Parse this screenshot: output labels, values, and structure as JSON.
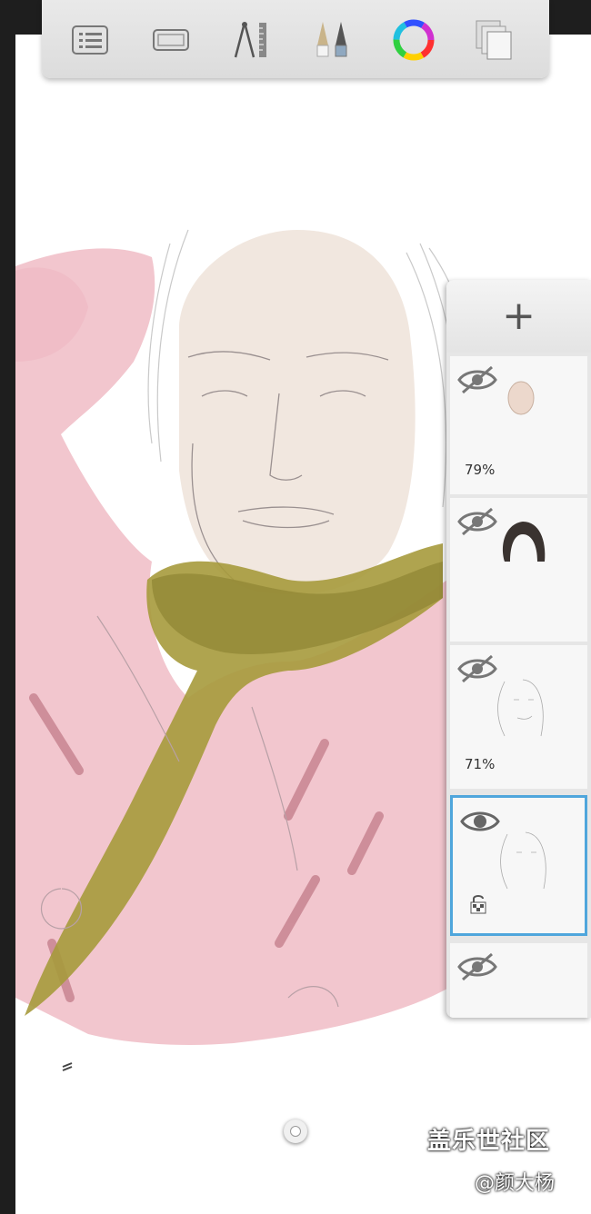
{
  "toolbar": {
    "tools": [
      {
        "name": "menu-list-icon"
      },
      {
        "name": "canvas-frame-icon"
      },
      {
        "name": "guides-ruler-icon"
      },
      {
        "name": "brushes-icon"
      },
      {
        "name": "color-wheel-icon"
      },
      {
        "name": "layers-icon"
      }
    ]
  },
  "layers": {
    "add_label": "+",
    "items": [
      {
        "visible": false,
        "opacity": "79%",
        "locked": false,
        "selected": false
      },
      {
        "visible": false,
        "opacity": "",
        "locked": false,
        "selected": false
      },
      {
        "visible": false,
        "opacity": "71%",
        "locked": false,
        "selected": false
      },
      {
        "visible": true,
        "opacity": "",
        "locked": true,
        "selected": true
      },
      {
        "visible": false,
        "opacity": "",
        "locked": false,
        "selected": false
      }
    ]
  },
  "watermark": {
    "title": "盖乐世社区",
    "author": "@颜大杨"
  },
  "colors": {
    "selection": "#4fa6dc",
    "coat": "#f2c6ce",
    "scarf": "#a69a3c",
    "skin": "#f1e7df"
  }
}
